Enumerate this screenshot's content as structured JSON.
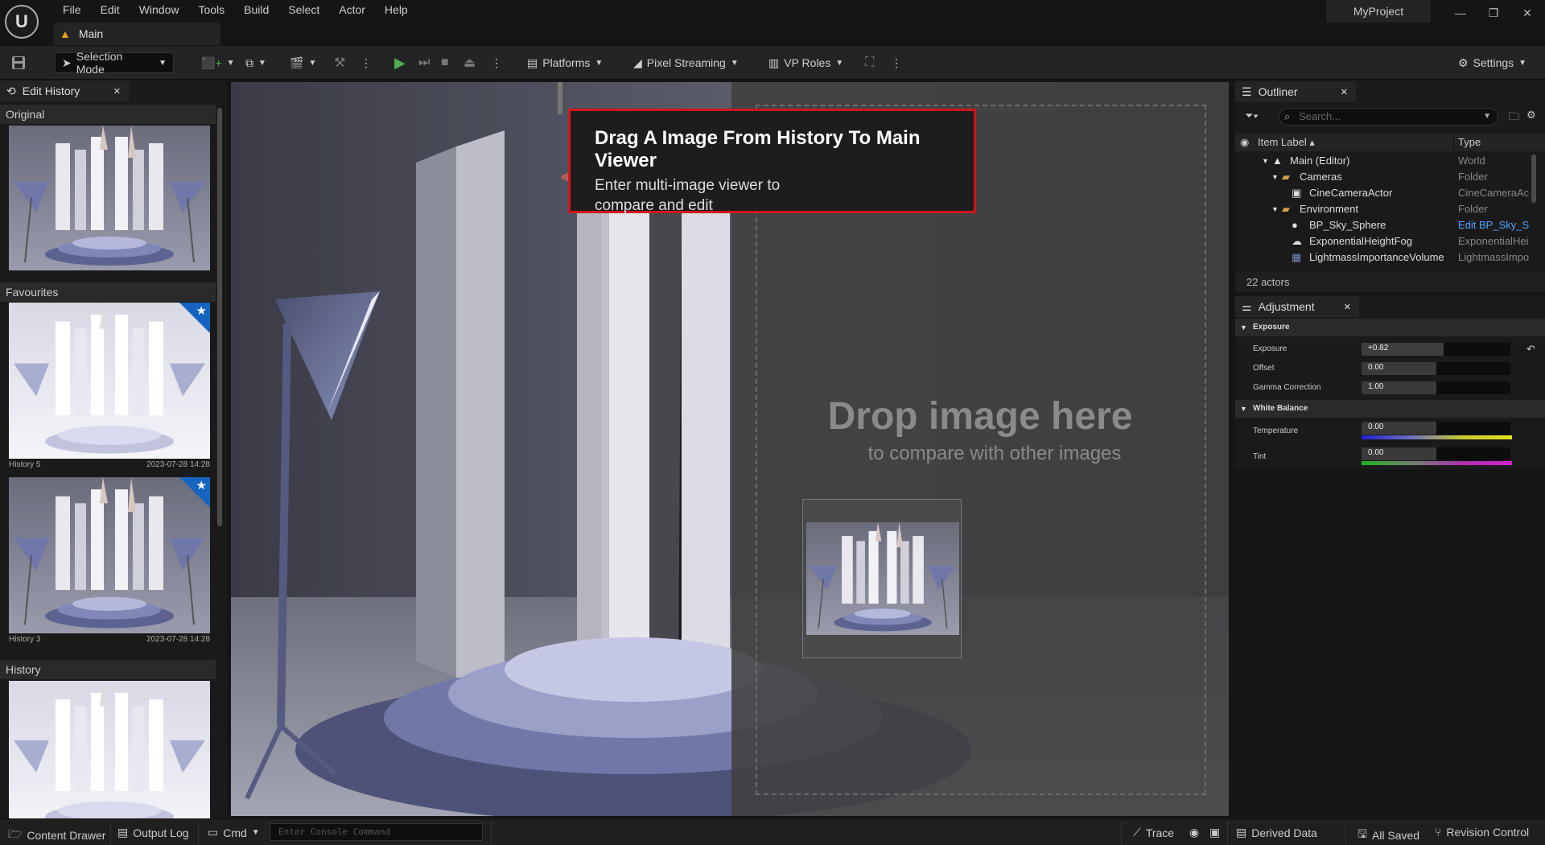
{
  "app": {
    "menu": [
      "File",
      "Edit",
      "Window",
      "Tools",
      "Build",
      "Select",
      "Actor",
      "Help"
    ],
    "level_tab": "Main",
    "project_name": "MyProject"
  },
  "toolbar": {
    "selection_mode": "Selection Mode",
    "platforms": "Platforms",
    "pixel_streaming": "Pixel Streaming",
    "vp_roles": "VP Roles",
    "settings": "Settings"
  },
  "edit_history": {
    "tab_label": "Edit History",
    "original_label": "Original",
    "favourites_label": "Favourites",
    "history_label": "History",
    "favourites": [
      {
        "name": "History 5",
        "timestamp": "2023-07-28 14:28"
      },
      {
        "name": "History 3",
        "timestamp": "2023-07-28 14:28"
      }
    ]
  },
  "viewer": {
    "tooltip_title": "Drag A Image From History To Main Viewer",
    "tooltip_body": "Enter multi-image viewer to\ncompare and edit",
    "drop_title": "Drop image here",
    "drop_subtitle": "to compare with other images"
  },
  "outliner": {
    "tab_label": "Outliner",
    "search_placeholder": "Search...",
    "col_label": "Item Label",
    "col_type": "Type",
    "rows": [
      {
        "label": "Main (Editor)",
        "type": "World"
      },
      {
        "label": "Cameras",
        "type": "Folder"
      },
      {
        "label": "CineCameraActor",
        "type": "CineCameraAc"
      },
      {
        "label": "Environment",
        "type": "Folder"
      },
      {
        "label": "BP_Sky_Sphere",
        "type": "Edit BP_Sky_S"
      },
      {
        "label": "ExponentialHeightFog",
        "type": "ExponentialHei"
      },
      {
        "label": "LightmassImportanceVolume",
        "type": "LightmassImpo"
      }
    ],
    "actor_count": "22 actors"
  },
  "adjustment": {
    "tab_label": "Adjustment",
    "exposure_section": "Exposure",
    "exposure_label": "Exposure",
    "exposure_value": "+0.82",
    "offset_label": "Offset",
    "offset_value": "0.00",
    "gamma_label": "Gamma Correction",
    "gamma_value": "1.00",
    "white_balance_section": "White Balance",
    "temperature_label": "Temperature",
    "temperature_value": "0.00",
    "tint_label": "Tint",
    "tint_value": "0.00"
  },
  "statusbar": {
    "content_drawer": "Content Drawer",
    "output_log": "Output Log",
    "cmd": "Cmd",
    "console_placeholder": "Enter Console Command",
    "trace": "Trace",
    "derived_data": "Derived Data",
    "all_saved": "All Saved",
    "revision_control": "Revision Control"
  },
  "colors": {
    "accent_red": "#d0161c",
    "favourite_blue": "#1565c0",
    "play_green": "#4caf50"
  }
}
